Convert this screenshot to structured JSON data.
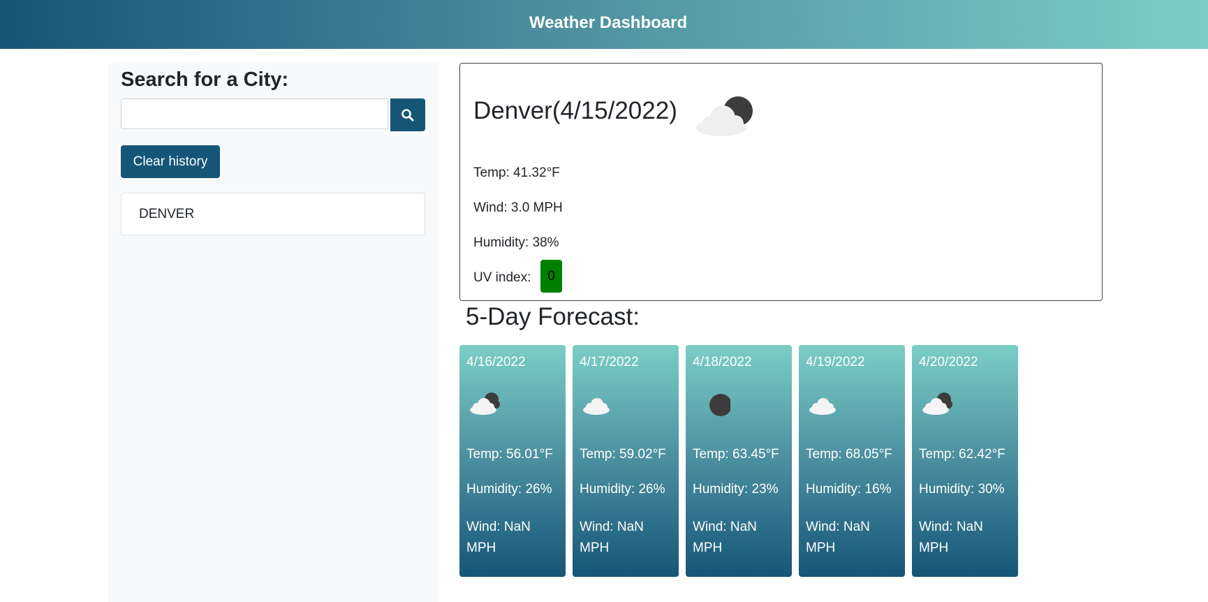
{
  "header": {
    "title": "Weather Dashboard"
  },
  "sidebar": {
    "search_label": "Search for a City:",
    "search_value": "",
    "search_icon": "search-icon",
    "clear_label": "Clear history",
    "history": [
      "DENVER"
    ]
  },
  "current": {
    "title": "Denver(4/15/2022)",
    "icon": "cloud-night-icon",
    "temp": "Temp: 41.32°F",
    "wind": "Wind: 3.0 MPH",
    "humidity": "Humidity: 38%",
    "uv_label": "UV index:",
    "uv_value": "0",
    "uv_color": "#008000"
  },
  "forecast": {
    "heading": "5-Day Forecast:",
    "days": [
      {
        "date": "4/16/2022",
        "icon": "cloud-night-icon",
        "temp": "Temp: 56.01°F",
        "humidity": "Humidity: 26%",
        "wind": "Wind: NaN MPH"
      },
      {
        "date": "4/17/2022",
        "icon": "cloud-icon",
        "temp": "Temp: 59.02°F",
        "humidity": "Humidity: 26%",
        "wind": "Wind: NaN MPH"
      },
      {
        "date": "4/18/2022",
        "icon": "moon-icon",
        "temp": "Temp: 63.45°F",
        "humidity": "Humidity: 23%",
        "wind": "Wind: NaN MPH"
      },
      {
        "date": "4/19/2022",
        "icon": "cloud-icon",
        "temp": "Temp: 68.05°F",
        "humidity": "Humidity: 16%",
        "wind": "Wind: NaN MPH"
      },
      {
        "date": "4/20/2022",
        "icon": "cloud-night-icon",
        "temp": "Temp: 62.42°F",
        "humidity": "Humidity: 30%",
        "wind": "Wind: NaN MPH"
      }
    ]
  },
  "colors": {
    "primary": "#155677",
    "gradient_light": "#7bcec6",
    "uv_low": "#008000"
  }
}
